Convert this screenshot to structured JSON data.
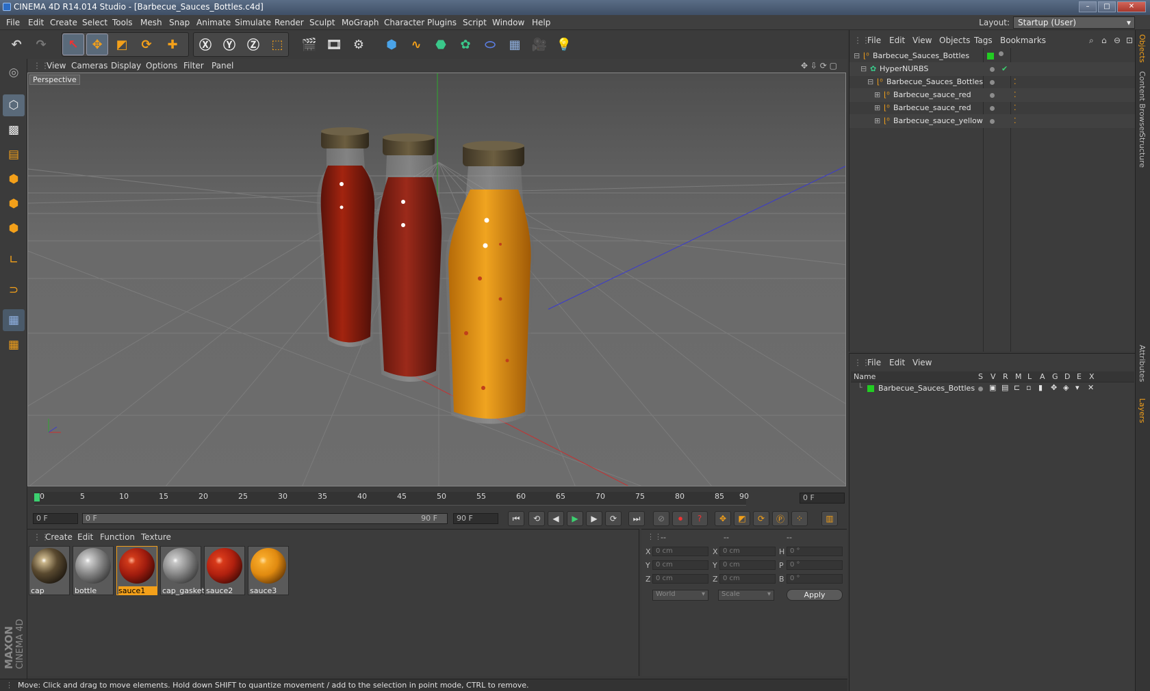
{
  "window": {
    "title": "CINEMA 4D R14.014 Studio - [Barbecue_Sauces_Bottles.c4d]"
  },
  "menu": [
    "File",
    "Edit",
    "Create",
    "Select",
    "Tools",
    "Mesh",
    "Snap",
    "Animate",
    "Simulate",
    "Render",
    "Sculpt",
    "MoGraph",
    "Character",
    "Plugins",
    "Script",
    "Window",
    "Help"
  ],
  "layout": {
    "label": "Layout:",
    "value": "Startup (User)"
  },
  "viewport": {
    "menu": [
      "View",
      "Cameras",
      "Display",
      "Options",
      "Filter",
      "Panel"
    ],
    "label": "Perspective"
  },
  "timeline": {
    "ticks": [
      "0",
      "5",
      "10",
      "15",
      "20",
      "25",
      "30",
      "35",
      "40",
      "45",
      "50",
      "55",
      "60",
      "65",
      "70",
      "75",
      "80",
      "85",
      "90"
    ],
    "current": "0 F"
  },
  "transport": {
    "start": "0 F",
    "range_start": "0 F",
    "range_end": "90 F",
    "end": "90 F"
  },
  "materials": {
    "menu": [
      "Create",
      "Edit",
      "Function",
      "Texture"
    ],
    "items": [
      {
        "name": "cap",
        "color": "#5a4a30"
      },
      {
        "name": "bottle",
        "color": "#8a8a8a"
      },
      {
        "name": "sauce1",
        "color": "#a01c0e"
      },
      {
        "name": "cap_gasket",
        "color": "#8c8c8c"
      },
      {
        "name": "sauce2",
        "color": "#b0200f"
      },
      {
        "name": "sauce3",
        "color": "#e08a10"
      }
    ]
  },
  "coords": {
    "header": [
      "--",
      "--",
      "--"
    ],
    "rows": [
      {
        "a": "X",
        "av": "0 cm",
        "b": "X",
        "bv": "0 cm",
        "c": "H",
        "cv": "0 °"
      },
      {
        "a": "Y",
        "av": "0 cm",
        "b": "Y",
        "bv": "0 cm",
        "c": "P",
        "cv": "0 °"
      },
      {
        "a": "Z",
        "av": "0 cm",
        "b": "Z",
        "bv": "0 cm",
        "c": "B",
        "cv": "0 °"
      }
    ],
    "mode1": "World",
    "mode2": "Scale",
    "apply": "Apply"
  },
  "objects": {
    "menu": [
      "File",
      "Edit",
      "View",
      "Objects",
      "Tags",
      "Bookmarks"
    ],
    "tree": [
      {
        "name": "Barbecue_Sauces_Bottles",
        "level": 0
      },
      {
        "name": "HyperNURBS",
        "level": 1
      },
      {
        "name": "Barbecue_Sauces_Bottles",
        "level": 2
      },
      {
        "name": "Barbecue_sauce_red",
        "level": 3
      },
      {
        "name": "Barbecue_sauce_red",
        "level": 3
      },
      {
        "name": "Barbecue_sauce_yellow",
        "level": 3
      }
    ]
  },
  "layers": {
    "menu": [
      "File",
      "Edit",
      "View"
    ],
    "columns": [
      "Name",
      "S",
      "V",
      "R",
      "M",
      "L",
      "A",
      "G",
      "D",
      "E",
      "X"
    ],
    "items": [
      {
        "name": "Barbecue_Sauces_Bottles",
        "color": "#22cc22"
      }
    ]
  },
  "right_tabs": [
    "Objects",
    "Content Browser",
    "Structure",
    "Attributes",
    "Layers"
  ],
  "brand": {
    "line1": "MAXON",
    "line2": "CINEMA 4D"
  },
  "status": "Move: Click and drag to move elements. Hold down SHIFT to quantize movement / add to the selection in point mode, CTRL to remove."
}
